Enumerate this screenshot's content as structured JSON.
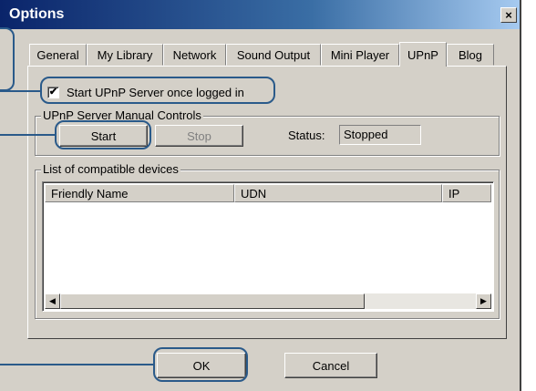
{
  "window": {
    "title": "Options",
    "close_label": "×"
  },
  "tabs": [
    {
      "label": "General"
    },
    {
      "label": "My Library"
    },
    {
      "label": "Network"
    },
    {
      "label": "Sound Output"
    },
    {
      "label": "Mini Player"
    },
    {
      "label": "UPnP",
      "active": true
    },
    {
      "label": "Blog"
    }
  ],
  "upnp": {
    "autostart_label": "Start UPnP Server once logged in",
    "autostart_checked": true,
    "check_glyph": "✔",
    "manual_group_label": "UPnP Server Manual Controls",
    "start_label": "Start",
    "stop_label": "Stop",
    "status_label": "Status:",
    "status_value": "Stopped",
    "devices_group_label": "List of compatible devices",
    "columns": [
      "Friendly Name",
      "UDN",
      "IP"
    ],
    "scroll_left": "◀",
    "scroll_right": "▶"
  },
  "footer": {
    "ok_label": "OK",
    "cancel_label": "Cancel"
  },
  "colors": {
    "callout": "#2a5a8a",
    "title_bar": "#0a246a"
  }
}
